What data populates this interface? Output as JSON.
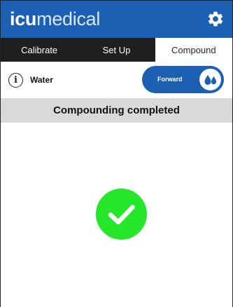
{
  "header": {
    "logo_bold": "icu",
    "logo_light": "medical",
    "settings_icon": "gear-icon",
    "colors": {
      "header_bg": "#1c60b4",
      "tab_bar_bg": "#1f1f1f"
    }
  },
  "tabs": [
    {
      "label": "Calibrate",
      "active": false
    },
    {
      "label": "Set Up",
      "active": false
    },
    {
      "label": "Compound",
      "active": true
    }
  ],
  "fluid": {
    "info_icon": "info-icon",
    "name": "Water"
  },
  "direction_toggle": {
    "label": "Forward",
    "icon": "droplets-icon",
    "color": "#1c60b4"
  },
  "status": {
    "message": "Compounding completed",
    "icon": "check-circle-icon",
    "icon_color": "#25e62a"
  }
}
